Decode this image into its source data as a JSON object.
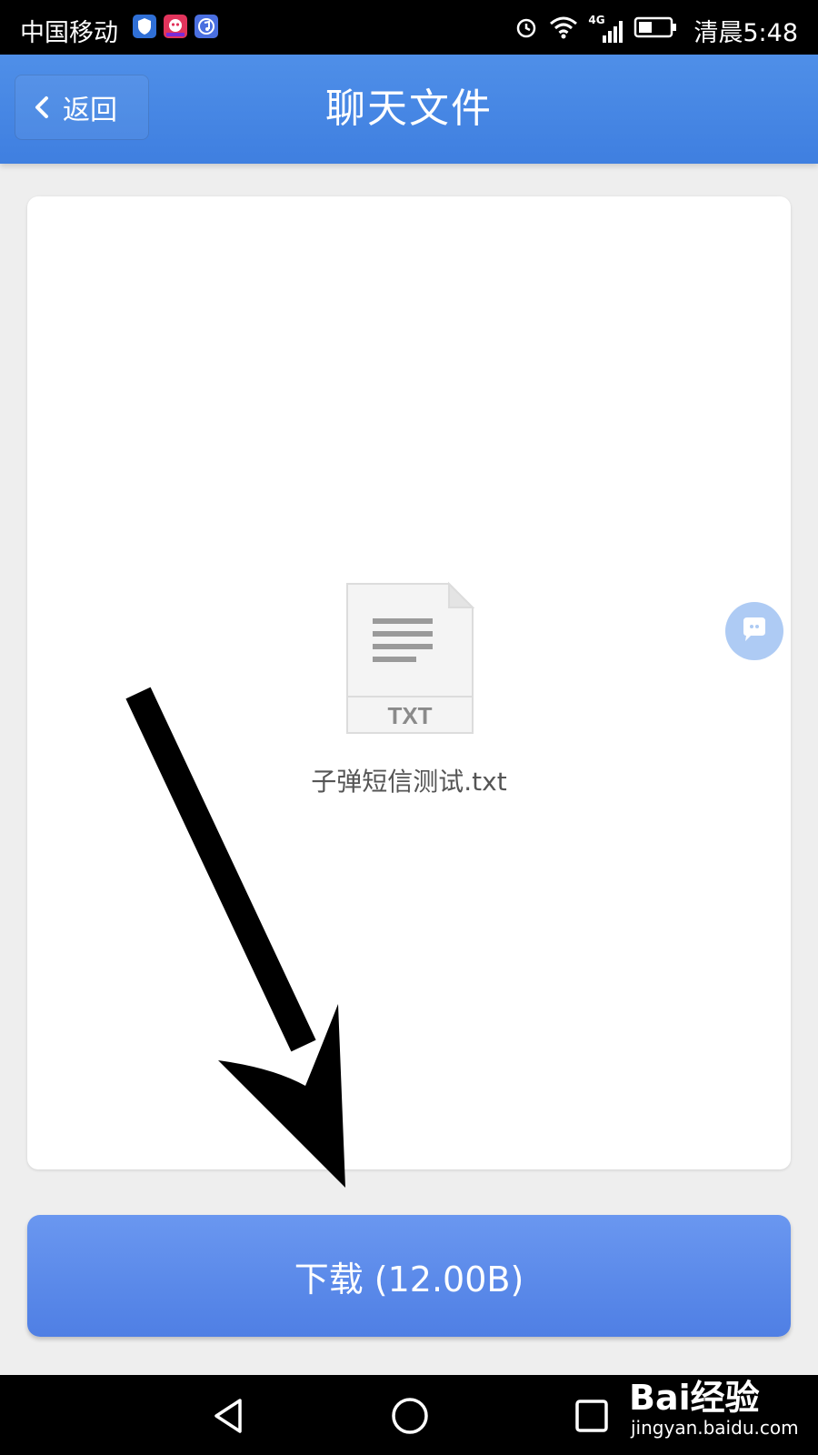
{
  "status_bar": {
    "carrier": "中国移动",
    "network": "4G",
    "time_prefix": "清晨",
    "time": "5:48"
  },
  "header": {
    "back_label": "返回",
    "title": "聊天文件"
  },
  "file": {
    "type_label": "TXT",
    "name": "子弹短信测试.txt"
  },
  "download": {
    "label": "下载 (12.00B)"
  },
  "watermark": {
    "brand": "Bai经验",
    "url": "jingyan.baidu.com"
  },
  "colors": {
    "header": "#4a8ae6",
    "download_button": "#5b8ae9",
    "float_button": "#aecbf4"
  }
}
